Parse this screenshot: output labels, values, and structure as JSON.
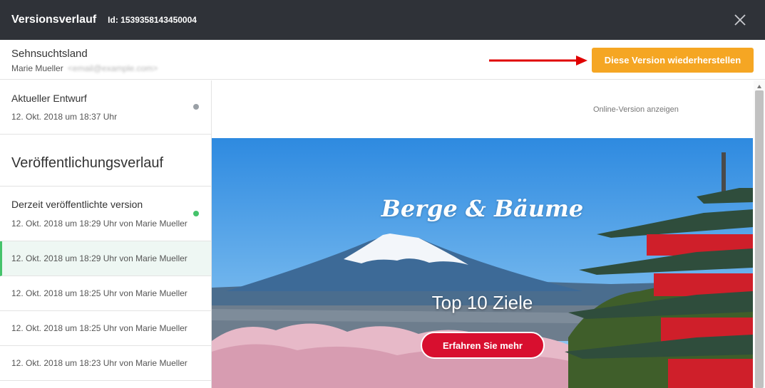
{
  "topbar": {
    "title": "Versionsverlauf",
    "id_text": "Id: 1539358143450004",
    "close_icon": "close-icon"
  },
  "header": {
    "name": "Sehnsuchtsland",
    "user_name": "Marie Mueller",
    "user_email": "<email@example.com>",
    "restore_button": "Diese Version wiederherstellen",
    "colors": {
      "restore_bg": "#f5a623",
      "arrow": "#e00000"
    }
  },
  "sidebar": {
    "draft": {
      "label": "Aktueller Entwurf",
      "date": "12. Okt. 2018 um 18:37 Uhr"
    },
    "publish_title": "Veröffentlichungsverlauf",
    "current": {
      "label": "Derzeit veröffentlichte version",
      "date": "12. Okt. 2018 um 18:29 Uhr von Marie Mueller"
    },
    "versions": [
      "12. Okt. 2018 um 18:29 Uhr von Marie Mueller",
      "12. Okt. 2018 um 18:25 Uhr von Marie Mueller",
      "12. Okt. 2018 um 18:25 Uhr von Marie Mueller",
      "12. Okt. 2018 um 18:23 Uhr von Marie Mueller"
    ],
    "active_index": 0
  },
  "preview": {
    "online_link": "Online-Version anzeigen",
    "hero_title": "Berge & Bäume",
    "hero_subtitle": "Top 10 Ziele",
    "cta": "Erfahren Sie mehr",
    "colors": {
      "cta_bg": "#d80f2f"
    }
  }
}
